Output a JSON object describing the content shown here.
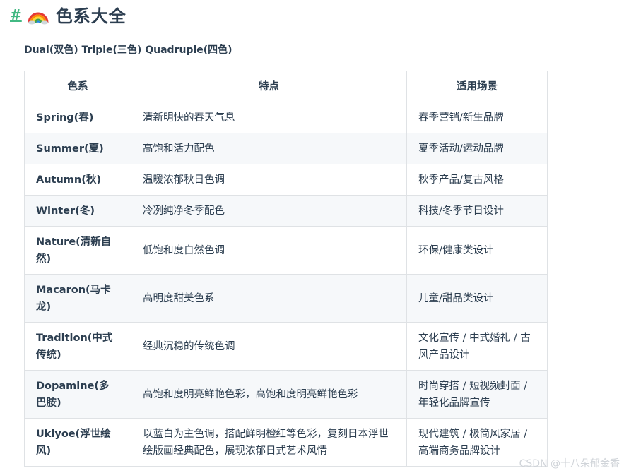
{
  "header": {
    "anchor": "#",
    "title": "色系大全"
  },
  "subtitle": "Dual(双色) Triple(三色) Quadruple(四色)",
  "table": {
    "columns": [
      "色系",
      "特点",
      "适用场景"
    ],
    "rows": [
      {
        "name": "Spring(春)",
        "feature": "清新明快的春天气息",
        "scene": "春季营销/新生品牌"
      },
      {
        "name": "Summer(夏)",
        "feature": "高饱和活力配色",
        "scene": "夏季活动/运动品牌"
      },
      {
        "name": "Autumn(秋)",
        "feature": "温暖浓郁秋日色调",
        "scene": "秋季产品/复古风格"
      },
      {
        "name": "Winter(冬)",
        "feature": "冷冽纯净冬季配色",
        "scene": "科技/冬季节日设计"
      },
      {
        "name": "Nature(清新自然)",
        "feature": "低饱和度自然色调",
        "scene": "环保/健康类设计"
      },
      {
        "name": "Macaron(马卡龙)",
        "feature": "高明度甜美色系",
        "scene": "儿童/甜品类设计"
      },
      {
        "name": "Tradition(中式传统)",
        "feature": "经典沉稳的传统色调",
        "scene": "文化宣传 / 中式婚礼 / 古风产品设计"
      },
      {
        "name": "Dopamine(多巴胺)",
        "feature": "高饱和度明亮鲜艳色彩，高饱和度明亮鲜艳色彩",
        "scene": "时尚穿搭 / 短视频封面 / 年轻化品牌宣传"
      },
      {
        "name": "Ukiyoe(浮世绘风)",
        "feature": "以蓝白为主色调，搭配鲜明橙红等色彩，复刻日本浮世绘版画经典配色，展现浓郁日式艺术风情",
        "scene": "现代建筑 / 极简风家居 / 高端商务品牌设计"
      }
    ]
  },
  "watermark": "CSDN @十八朵郁金香"
}
